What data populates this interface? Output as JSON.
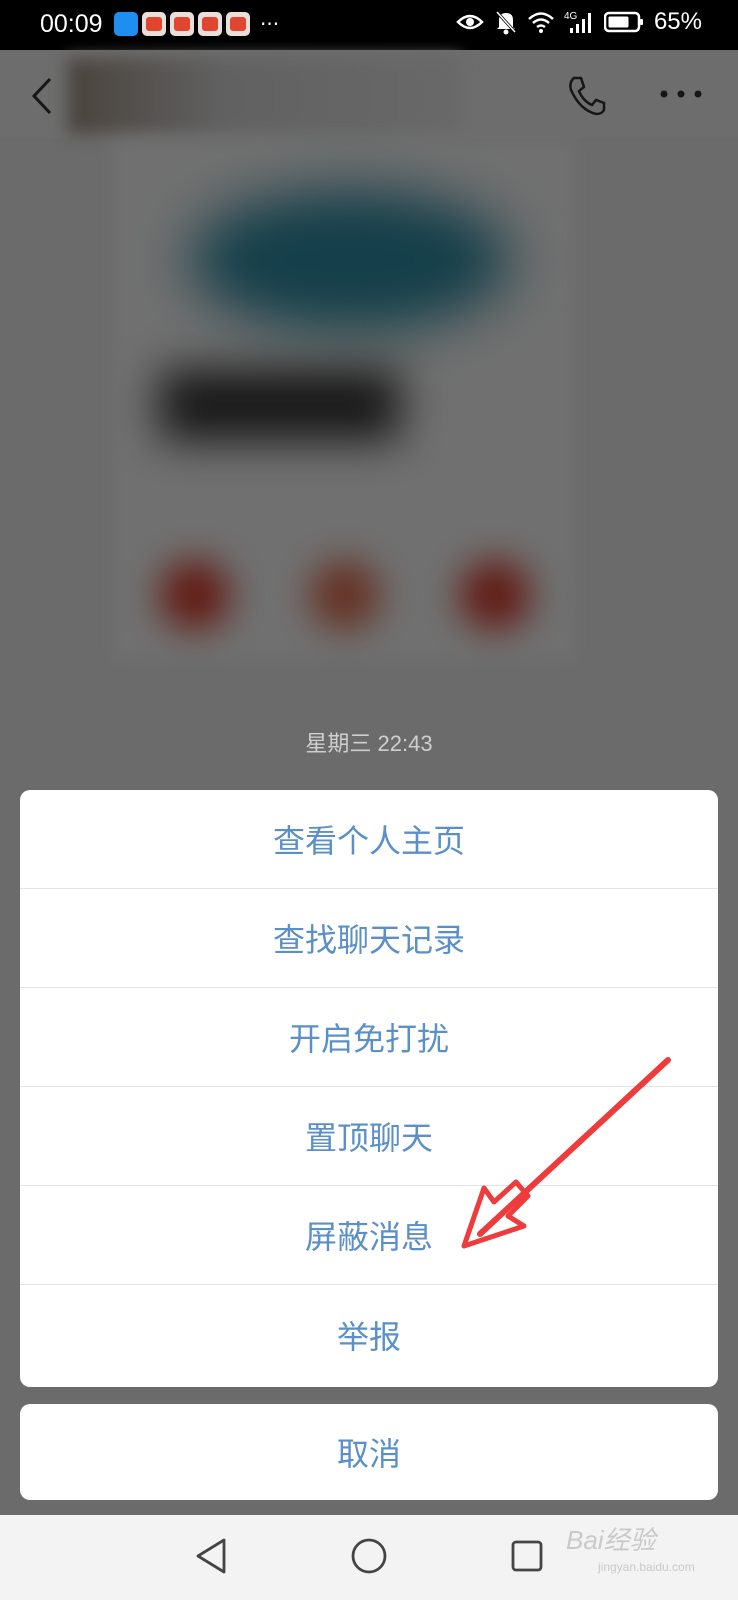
{
  "status_bar": {
    "time": "00:09",
    "more": "···",
    "network": "4G",
    "battery_percent": "65%"
  },
  "chat": {
    "timestamp": "星期三 22:43"
  },
  "action_sheet": {
    "items": [
      {
        "label": "查看个人主页"
      },
      {
        "label": "查找聊天记录"
      },
      {
        "label": "开启免打扰"
      },
      {
        "label": "置顶聊天"
      },
      {
        "label": "屏蔽消息"
      },
      {
        "label": "举报"
      }
    ],
    "cancel_label": "取消"
  },
  "watermark": {
    "brand": "Bai经验",
    "url": "jingyan.baidu.com"
  },
  "colors": {
    "action_text": "#5a8fc8",
    "annotation_arrow": "#ee3b3b"
  }
}
